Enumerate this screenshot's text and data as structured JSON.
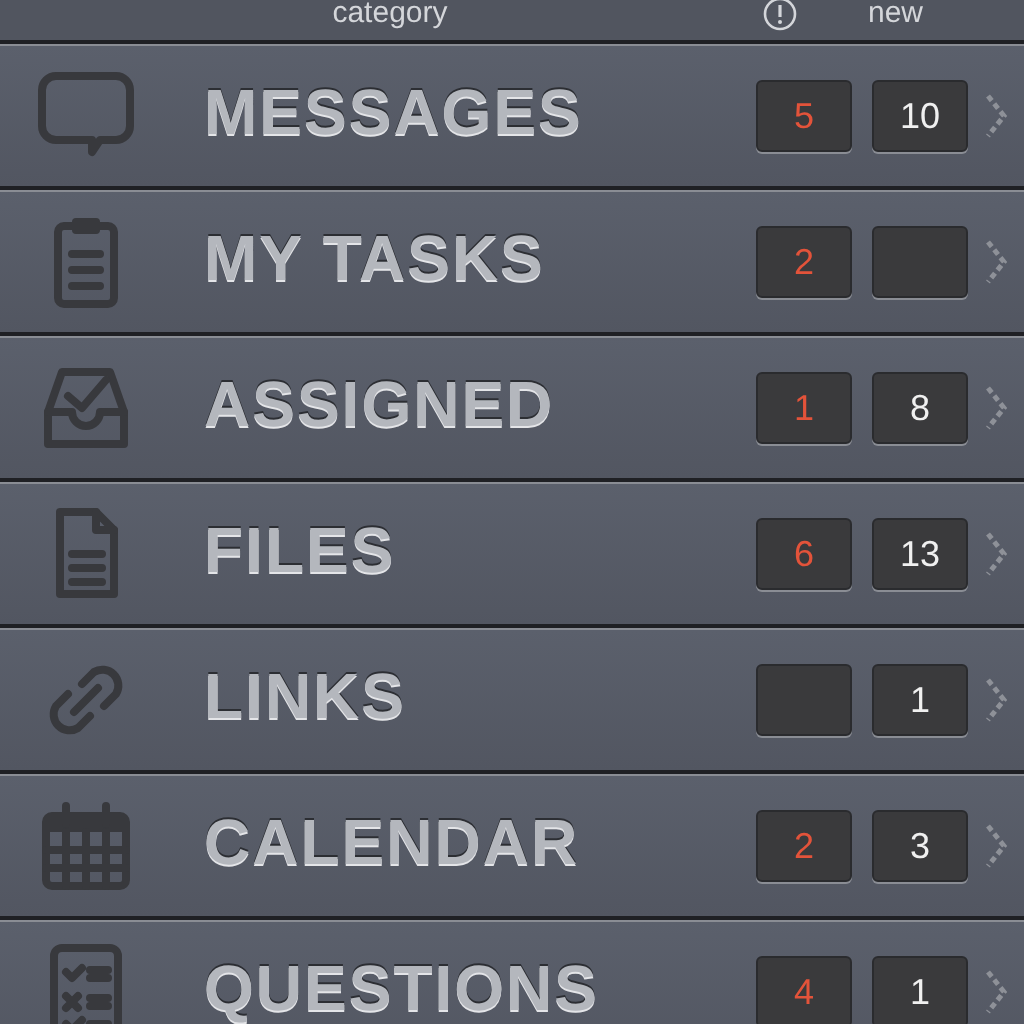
{
  "header": {
    "category": "category",
    "new": "new"
  },
  "rows": [
    {
      "label": "MESSAGES",
      "alerts": "5",
      "new": "10"
    },
    {
      "label": "MY TASKS",
      "alerts": "2"
    },
    {
      "label": "ASSIGNED",
      "alerts": "1",
      "new": "8"
    },
    {
      "label": "FILES",
      "alerts": "6",
      "new": "13"
    },
    {
      "label": "LINKS",
      "new": "1"
    },
    {
      "label": "CALENDAR",
      "alerts": "2",
      "new": "3"
    },
    {
      "label": "QUESTIONS",
      "alerts": "4",
      "new": "1"
    }
  ]
}
